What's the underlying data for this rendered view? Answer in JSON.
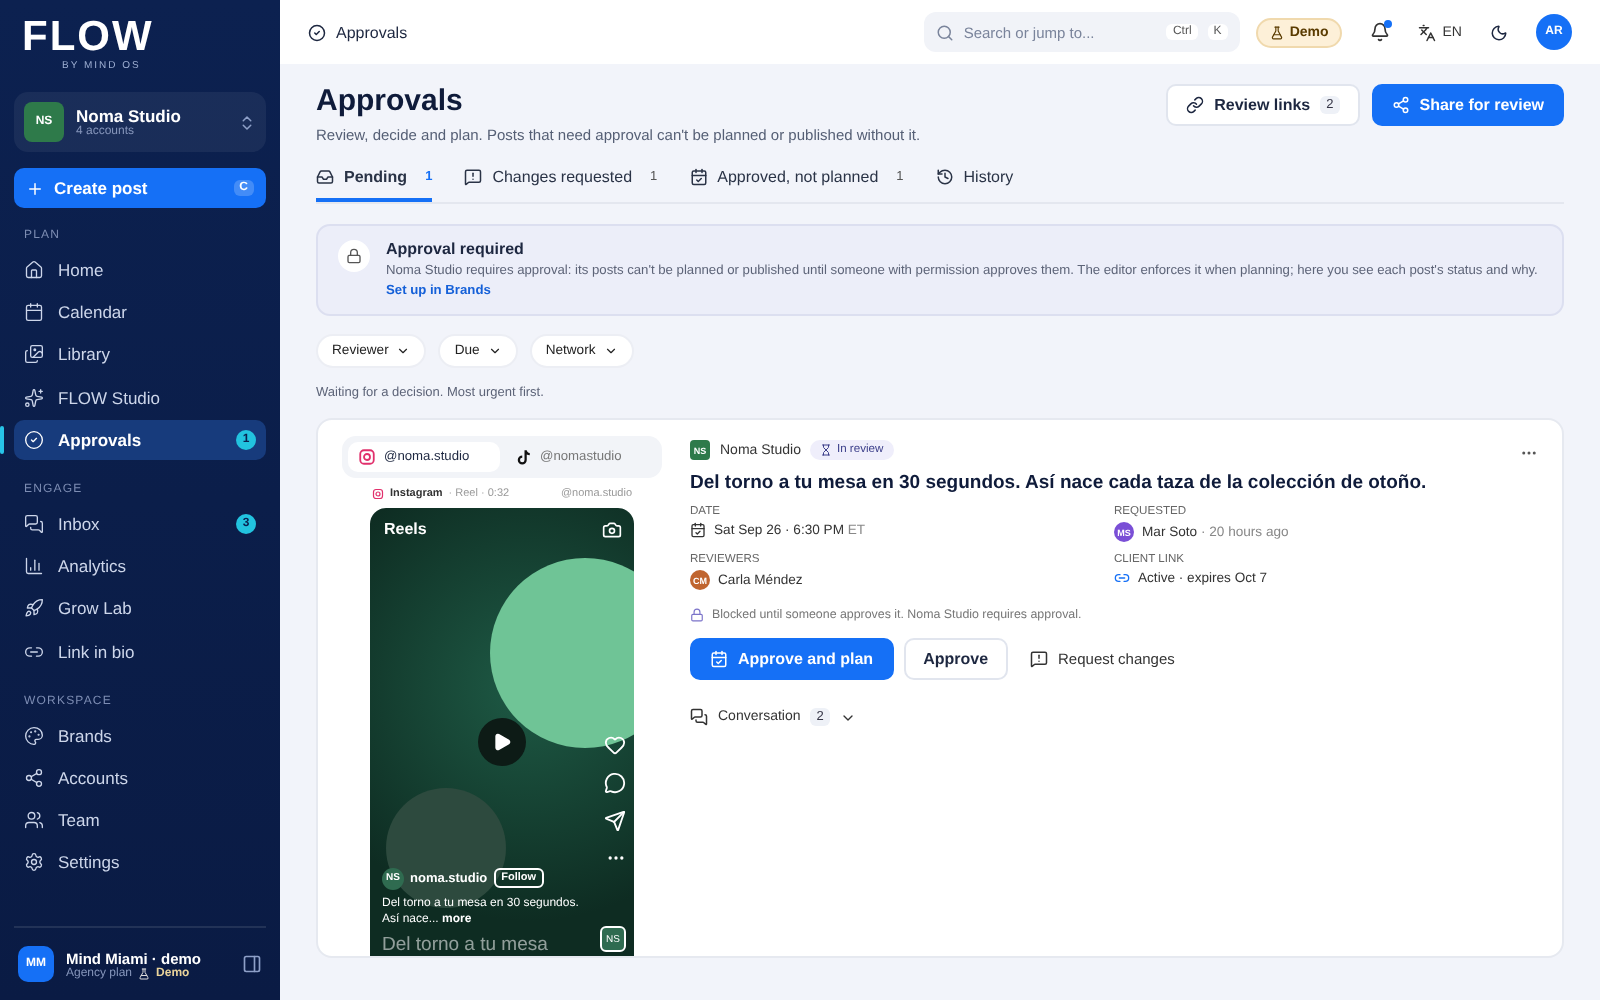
{
  "sidebar": {
    "logo": "FLOW",
    "tagline": "BY MIND OS",
    "workspace": {
      "initials": "NS",
      "name": "Noma Studio",
      "subtitle": "4 accounts"
    },
    "create": {
      "label": "Create post",
      "shortcut": "C"
    },
    "sections": [
      {
        "title": "PLAN",
        "items": [
          {
            "label": "Home",
            "selected": false
          },
          {
            "label": "Calendar",
            "selected": false
          },
          {
            "label": "Library",
            "selected": false
          },
          {
            "label": "FLOW Studio",
            "selected": false
          },
          {
            "label": "Approvals",
            "selected": true,
            "badge": "1"
          }
        ]
      },
      {
        "title": "ENGAGE",
        "items": [
          {
            "label": "Inbox",
            "selected": false,
            "badge": "3"
          },
          {
            "label": "Analytics",
            "selected": false
          },
          {
            "label": "Grow Lab",
            "selected": false
          },
          {
            "label": "Link in bio",
            "selected": false
          }
        ]
      },
      {
        "title": "WORKSPACE",
        "items": [
          {
            "label": "Brands",
            "selected": false
          },
          {
            "label": "Accounts",
            "selected": false
          },
          {
            "label": "Team",
            "selected": false
          },
          {
            "label": "Settings",
            "selected": false
          }
        ]
      }
    ],
    "user": {
      "initials": "MM",
      "name": "Mind Miami · demo",
      "plan": "Agency plan",
      "badge": "Demo"
    }
  },
  "topbar": {
    "breadcrumb": "Approvals",
    "search": {
      "placeholder": "Search or jump to..."
    },
    "keys": [
      "Ctrl",
      "K"
    ],
    "demo": "Demo",
    "language": "EN",
    "avatar": "AR"
  },
  "header": {
    "title": "Approvals",
    "subtitle": "Review, decide and plan. Posts that need approval can't be planned or published without it.",
    "review_links": {
      "label": "Review links",
      "count": "2"
    },
    "share": "Share for review"
  },
  "tabs": [
    {
      "label": "Pending",
      "count": "1",
      "selected": true
    },
    {
      "label": "Changes requested",
      "count": "1",
      "selected": false
    },
    {
      "label": "Approved, not planned",
      "count": "1",
      "selected": false
    },
    {
      "label": "History",
      "selected": false
    }
  ],
  "notice": {
    "title": "Approval required",
    "text": "Noma Studio requires approval: its posts can't be planned or published until someone with permission approves them. The editor enforces it when planning; here you see each post's status and why.",
    "link": "Set up in Brands"
  },
  "filters": [
    "Reviewer",
    "Due",
    "Network"
  ],
  "waiting": "Waiting for a decision. Most urgent first.",
  "card": {
    "accounts": [
      {
        "handle": "@noma.studio",
        "selected": true
      },
      {
        "handle": "@nomastudio",
        "selected": false
      }
    ],
    "meta": {
      "network": "Instagram",
      "details": "· Reel · 0:32",
      "handle": "@noma.studio"
    },
    "reel": {
      "header": "Reels",
      "initials": "NS",
      "user": "noma.studio",
      "follow": "Follow",
      "caption": "Del torno a tu mesa en 30 segundos. Así nace...",
      "more": "more",
      "overlay": "Del torno a tu mesa",
      "corner": "NS"
    },
    "brand": {
      "initials": "NS",
      "name": "Noma Studio"
    },
    "status": "In review",
    "title": "Del torno a tu mesa en 30 segundos. Así nace cada taza de la colección de otoño.",
    "date": {
      "label": "DATE",
      "value": "Sat Sep 26 · 6:30 PM",
      "zone": "ET"
    },
    "requested": {
      "label": "REQUESTED",
      "initials": "MS",
      "name": "Mar Soto",
      "when": "· 20 hours ago"
    },
    "reviewers": {
      "label": "REVIEWERS",
      "initials": "CM",
      "name": "Carla Méndez"
    },
    "client_link": {
      "label": "CLIENT LINK",
      "value": "Active · expires Oct 7"
    },
    "blocked": "Blocked until someone approves it. Noma Studio requires approval.",
    "actions": {
      "primary": "Approve and plan",
      "secondary": "Approve",
      "tertiary": "Request changes"
    },
    "conversation": {
      "label": "Conversation",
      "count": "2"
    }
  }
}
